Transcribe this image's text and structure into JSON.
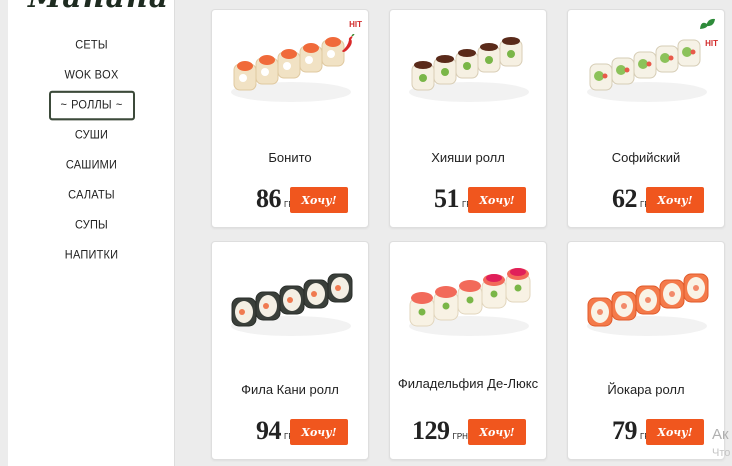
{
  "logo": {
    "text": "Mañana"
  },
  "menu": {
    "items": [
      {
        "label": "СЕТЫ"
      },
      {
        "label": "WOK BOX"
      },
      {
        "label": "РОЛЛЫ"
      },
      {
        "label": "СУШИ"
      },
      {
        "label": "САШИМИ"
      },
      {
        "label": "САЛАТЫ"
      },
      {
        "label": "СУПЫ"
      },
      {
        "label": "НАПИТКИ"
      }
    ],
    "active": "РОЛЛЫ"
  },
  "currency": "ГРН.",
  "order_label": "Хочу!",
  "badges": {
    "hit": "HIT"
  },
  "products": [
    {
      "name": "Бонито",
      "price": "86",
      "badge": "HIT",
      "badge_icon": "chili-icon"
    },
    {
      "name": "Хияши ролл",
      "price": "51"
    },
    {
      "name": "Софийский",
      "price": "62",
      "badge": "HIT",
      "badge_icon": "leaf-icon"
    },
    {
      "name": "Фила Кани ролл",
      "price": "94"
    },
    {
      "name": "Филадельфия Де-Люкс",
      "price": "129"
    },
    {
      "name": "Йокара ролл",
      "price": "79"
    }
  ],
  "watermark": {
    "line1": "Ак",
    "line2": "Что"
  },
  "colors": {
    "accent": "#f0561e",
    "hit": "#d22a2a",
    "leaf": "#2e8b3a",
    "frame": "#3c4a3a"
  }
}
